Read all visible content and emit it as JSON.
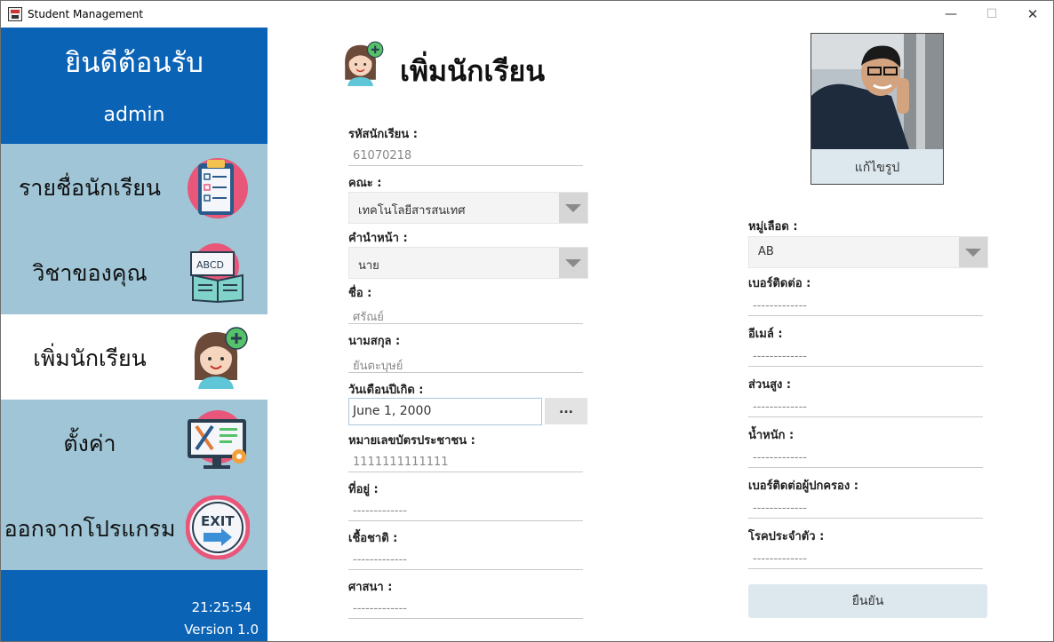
{
  "window": {
    "title": "Student Management",
    "minimize": "—",
    "maximize": "☐",
    "close": "✕"
  },
  "sidebar": {
    "welcome": "ยินดีต้อนรับ",
    "user": "admin",
    "items": [
      {
        "label": "รายชื่อนักเรียน",
        "icon": "clipboard-list-icon"
      },
      {
        "label": "วิชาของคุณ",
        "icon": "book-abcd-icon"
      },
      {
        "label": "เพิ่มนักเรียน",
        "icon": "add-student-icon"
      },
      {
        "label": "ตั้งค่า",
        "icon": "settings-tools-icon"
      },
      {
        "label": "ออกจากโปรแกรม",
        "icon": "exit-icon"
      }
    ],
    "active_index": 2,
    "clock": "21:25:54",
    "version": "Version 1.0"
  },
  "page": {
    "title": "เพิ่มนักเรียน"
  },
  "form_left": {
    "student_id": {
      "label": "รหัสนักเรียน :",
      "value": "61070218"
    },
    "faculty": {
      "label": "คณะ :",
      "value": "เทคโนโลยีสารสนเทศ"
    },
    "prefix": {
      "label": "คำนำหน้า :",
      "value": "นาย"
    },
    "first_name": {
      "label": "ชื่อ :",
      "value": "ศรัณย์"
    },
    "last_name": {
      "label": "นามสกุล :",
      "value": "ยันตะบุษย์"
    },
    "birthdate": {
      "label": "วันเดือนปีเกิด :",
      "value": "June 1, 2000",
      "button": "..."
    },
    "id_card": {
      "label": "หมายเลขบัตรประชาชน :",
      "value": "1111111111111"
    },
    "address": {
      "label": "ที่อยู่ :",
      "value": "-------------"
    },
    "ethnicity": {
      "label": "เชื้อชาติ :",
      "value": "-------------"
    },
    "religion": {
      "label": "ศาสนา :",
      "value": "-------------"
    }
  },
  "form_right": {
    "blood_type": {
      "label": "หมู่เลือด :",
      "value": "AB"
    },
    "phone": {
      "label": "เบอร์ติดต่อ :",
      "value": "-------------"
    },
    "email": {
      "label": "อีเมล์ :",
      "value": "-------------"
    },
    "height": {
      "label": "ส่วนสูง :",
      "value": "-------------"
    },
    "weight": {
      "label": "น้ำหนัก :",
      "value": "-------------"
    },
    "parent_phone": {
      "label": "เบอร์ติดต่อผู้ปกครอง :",
      "value": "-------------"
    },
    "disease": {
      "label": "โรคประจำตัว :",
      "value": "-------------"
    }
  },
  "photo": {
    "edit_label": "แก้ไขรูป"
  },
  "confirm_label": "ยืนยัน",
  "colors": {
    "sidebar_header": "#0b63b6",
    "sidebar_bg": "#9fc5d6",
    "button_bg": "#dce8ee"
  }
}
